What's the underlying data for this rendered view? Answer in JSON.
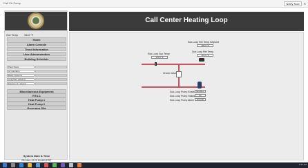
{
  "browser": {
    "tab_title": "Call Ctr Pump",
    "toolbar_text": "Notify Now",
    "close_glyph": "✕"
  },
  "header": {
    "title": "Call Center Heating Loop"
  },
  "sidebar": {
    "oat_label": "Out Temp",
    "oat_value": "56.0 °F",
    "nav": [
      "Home",
      "Alarm Console",
      "Trend Information",
      "User Administration",
      "Building Schedule"
    ],
    "selects": [
      "Plant Plans",
      "Air Handlers",
      "Boiler Systems",
      "Unit Plant Labeled",
      "Equipment Labeled"
    ],
    "misc": [
      "Miscellaneous Equipment",
      "RTU-1",
      "Heat Pump 1",
      "Heat Pump 2",
      "Generator Site"
    ],
    "system_datetime_label": "System Date & Time",
    "system_datetime_value": "05-Nov-19 9:14 AM CST"
  },
  "diagram": {
    "sub_loop_ret_temp_setpoint": {
      "label": "Sub-Loop Ret Temp Setpoint",
      "value": "165.0 °F"
    },
    "sub_loop_ret_temp": {
      "label": "Sub-Loop Ret Temp",
      "value": "161.6 °F"
    },
    "sub_loop_sup_temp": {
      "label": "Sub-Loop Sup Temp",
      "value": "170.0 °F"
    },
    "check_valve": {
      "label": "Check Valve"
    },
    "pump_enable": {
      "label": "Sub-Loop Pump Enable",
      "value": "Enabled"
    },
    "pump_status": {
      "label": "Sub-Loop Pump Status",
      "value": "On"
    },
    "pump_alarm": {
      "label": "Sub-Loop Pump Alarm",
      "value": "Normal"
    }
  },
  "taskbar": {
    "clock": "9:14 AM"
  },
  "colors": {
    "pipe_red": "#c2545b",
    "header_dark": "#3b3b3b",
    "pump_blue": "#2c3d66"
  }
}
